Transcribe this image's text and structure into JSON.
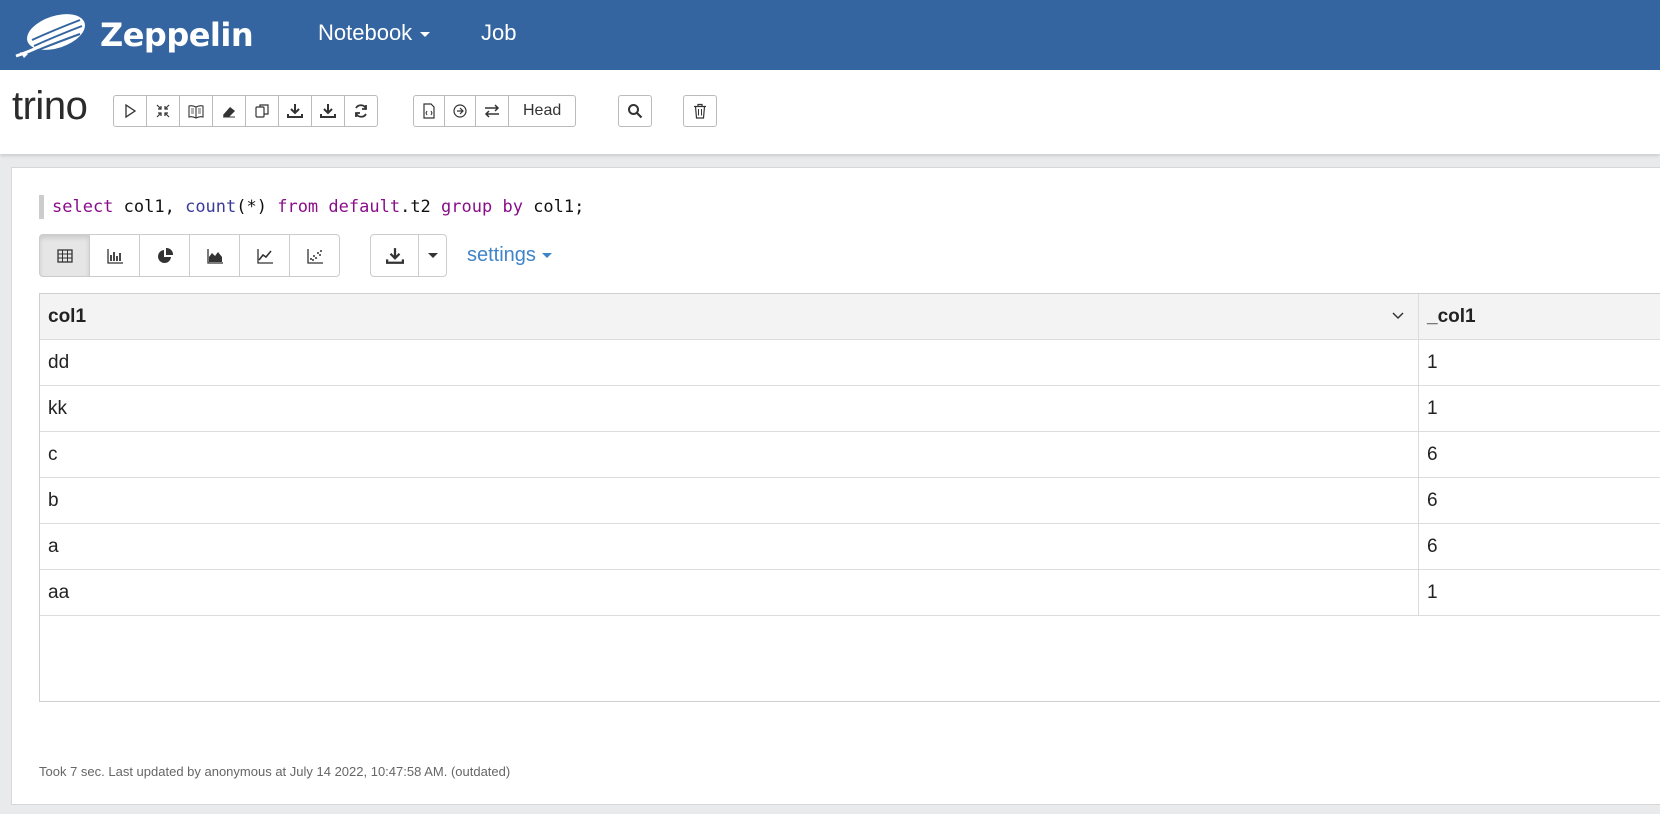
{
  "app": {
    "name": "Zeppelin"
  },
  "nav": {
    "notebook_label": "Notebook",
    "job_label": "Job"
  },
  "note": {
    "title": "trino",
    "head_label": "Head"
  },
  "paragraph": {
    "code": {
      "t1": "select",
      "t2": " col1, ",
      "t3": "count",
      "t4": "(*) ",
      "t5": "from",
      "t6": " ",
      "t7": "default",
      "t8": ".t2 ",
      "t9": "group",
      "t10": " ",
      "t11": "by",
      "t12": " col1;"
    },
    "settings_label": "settings",
    "table": {
      "columns": [
        "col1",
        "_col1"
      ],
      "rows": [
        [
          "dd",
          "1"
        ],
        [
          "kk",
          "1"
        ],
        [
          "c",
          "6"
        ],
        [
          "b",
          "6"
        ],
        [
          "a",
          "6"
        ],
        [
          "aa",
          "1"
        ]
      ]
    },
    "footer": "Took 7 sec. Last updated by anonymous at July 14 2022, 10:47:58 AM. (outdated)"
  },
  "colors": {
    "navbar": "#3465a0",
    "keyword": "#8a0e8a",
    "link": "#3f84c9"
  }
}
